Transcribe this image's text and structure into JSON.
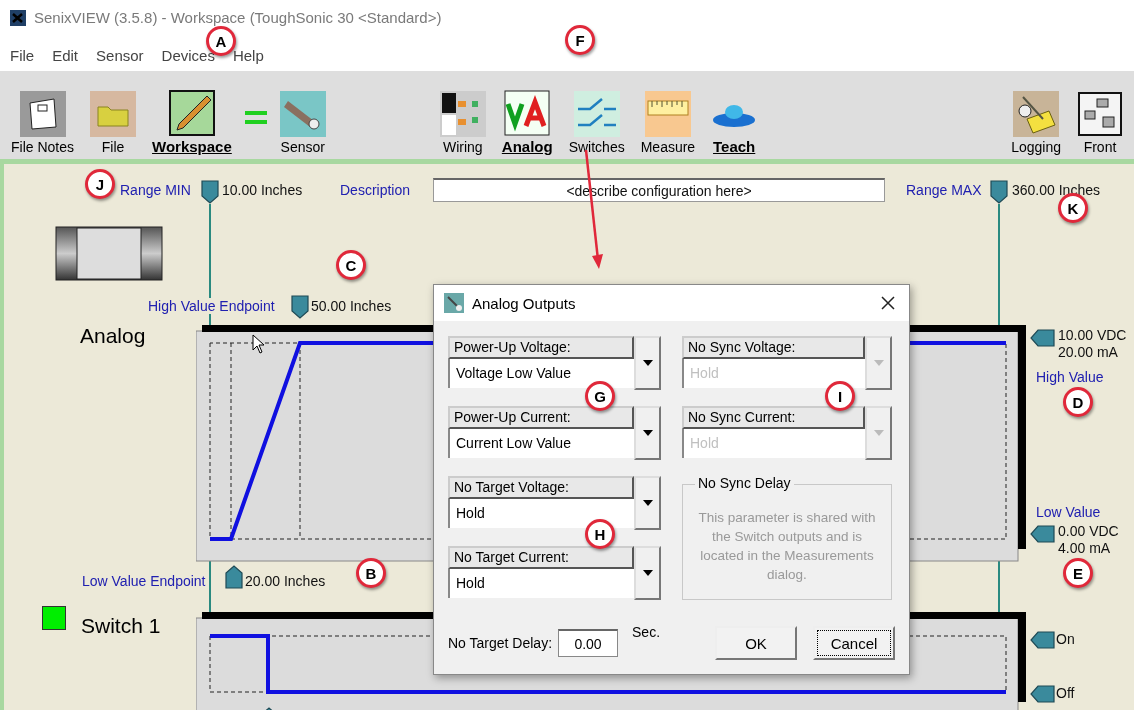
{
  "window": {
    "title": "SenixVIEW (3.5.8) - Workspace (ToughSonic 30 <Standard>)"
  },
  "menu": [
    "File",
    "Edit",
    "Sensor",
    "Devices",
    "Help"
  ],
  "toolbar": {
    "groups": [
      [
        {
          "label": "File Notes",
          "kind": "notes",
          "active": false
        },
        {
          "label": "File",
          "kind": "folder",
          "active": false
        },
        {
          "label": "Workspace",
          "kind": "workspace",
          "active": true
        },
        {
          "label": "Sensor",
          "kind": "sensor",
          "active": false
        }
      ],
      [
        {
          "label": "Wiring",
          "kind": "wiring",
          "active": false
        },
        {
          "label": "Analog",
          "kind": "analog",
          "active": true
        },
        {
          "label": "Switches",
          "kind": "switches",
          "active": false
        },
        {
          "label": "Measure",
          "kind": "measure",
          "active": false
        },
        {
          "label": "Teach",
          "kind": "teach",
          "active": true
        }
      ],
      [
        {
          "label": "Logging",
          "kind": "logging",
          "active": false
        },
        {
          "label": "Front",
          "kind": "front",
          "active": false
        }
      ]
    ]
  },
  "workspace": {
    "range_min": {
      "label": "Range MIN",
      "value": "10.00 Inches"
    },
    "description": {
      "label": "Description",
      "value": "<describe configuration here>"
    },
    "range_max": {
      "label": "Range MAX",
      "value": "360.00 Inches"
    },
    "analog": {
      "title": "Analog",
      "high_endpoint": {
        "label": "High Value Endpoint",
        "value": "50.00 Inches"
      },
      "low_endpoint": {
        "label": "Low Value Endpoint",
        "value": "20.00 Inches"
      },
      "high_value": {
        "label": "High Value",
        "voltage": "10.00 VDC",
        "current": "20.00 mA"
      },
      "low_value": {
        "label": "Low Value",
        "voltage": "0.00 VDC",
        "current": "4.00 mA"
      }
    },
    "switch": {
      "title": "Switch 1",
      "on_label": "On",
      "off_label": "Off"
    }
  },
  "dialog": {
    "title": "Analog Outputs",
    "combos": [
      {
        "label": "Power-Up Voltage:",
        "value": "Voltage Low Value",
        "disabled": false
      },
      {
        "label": "No Sync Voltage:",
        "value": "Hold",
        "disabled": true
      },
      {
        "label": "Power-Up Current:",
        "value": "Current Low Value",
        "disabled": false
      },
      {
        "label": "No Sync Current:",
        "value": "Hold",
        "disabled": true
      },
      {
        "label": "No Target Voltage:",
        "value": "Hold",
        "disabled": false
      },
      {
        "label": "No Target Current:",
        "value": "Hold",
        "disabled": false
      }
    ],
    "delay_group": {
      "title": "No Sync Delay",
      "text": "This parameter is shared with the Switch outputs and is located in the Measurements dialog."
    },
    "no_target_delay": {
      "label": "No Target Delay:",
      "value": "0.00",
      "unit": "Sec."
    },
    "buttons": [
      {
        "label": "OK",
        "focused": false
      },
      {
        "label": "Cancel",
        "focused": true
      }
    ]
  },
  "callouts": [
    {
      "label": "A"
    },
    {
      "label": "F"
    },
    {
      "label": "J"
    },
    {
      "label": "K"
    },
    {
      "label": "C"
    },
    {
      "label": "D"
    },
    {
      "label": "E"
    },
    {
      "label": "B"
    },
    {
      "label": "G"
    },
    {
      "label": "I"
    },
    {
      "label": "H"
    }
  ]
}
